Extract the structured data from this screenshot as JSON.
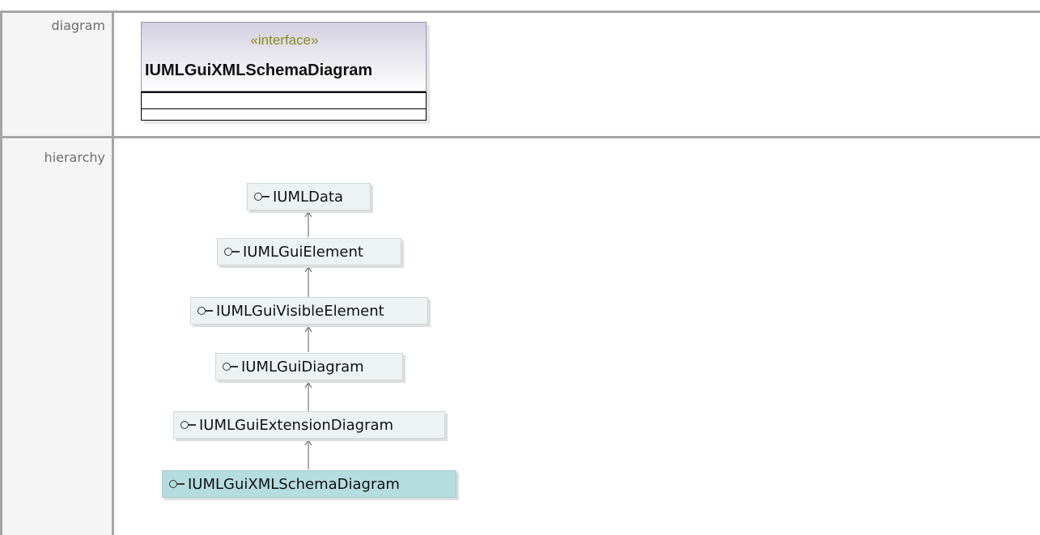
{
  "rows": {
    "diagram_label": "diagram",
    "hierarchy_label": "hierarchy"
  },
  "diagram": {
    "stereotype": "«interface»",
    "class_name": "IUMLGuiXMLSchemaDiagram"
  },
  "hierarchy": {
    "nodes": [
      {
        "label": "IUMLData",
        "icon": "interface-lollipop-icon"
      },
      {
        "label": "IUMLGuiElement",
        "icon": "interface-lollipop-icon"
      },
      {
        "label": "IUMLGuiVisibleElement",
        "icon": "interface-lollipop-icon"
      },
      {
        "label": "IUMLGuiDiagram",
        "icon": "interface-lollipop-icon"
      },
      {
        "label": "IUMLGuiExtensionDiagram",
        "icon": "interface-lollipop-icon"
      },
      {
        "label": "IUMLGuiXMLSchemaDiagram",
        "icon": "interface-lollipop-icon",
        "current": true
      }
    ]
  },
  "colors": {
    "label_bg": "#f5f5f5",
    "separator": "#a6a6a6",
    "node_bg": "#edf2f2",
    "current_node_bg": "#b5dcde",
    "stereotype": "#8a8a1a"
  }
}
